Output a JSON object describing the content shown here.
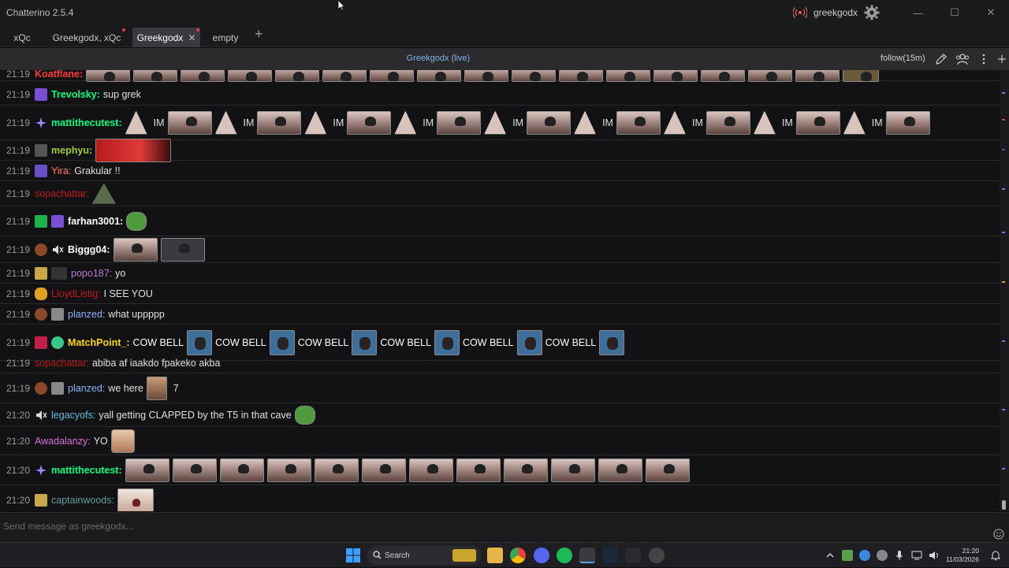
{
  "window": {
    "app_title": "Chatterino 2.5.4",
    "username": "greekgodx",
    "min_label": "—",
    "max_label": "☐",
    "close_label": "✕"
  },
  "tabs": [
    {
      "label": "xQc",
      "active": false
    },
    {
      "label": "Greekgodx, xQc",
      "active": false
    },
    {
      "label": "Greekgodx",
      "active": true
    },
    {
      "label": "empty",
      "active": false
    }
  ],
  "add_tab_label": "+",
  "channel_header": {
    "title": "Greekgodx (live)",
    "follow_mode": "follow(15m)"
  },
  "chat": [
    {
      "ts": "21:19",
      "user": "Koatflane:",
      "color": "#ff3b3b",
      "text": "",
      "emotes": "row"
    },
    {
      "ts": "21:19",
      "user": "Trevolsky:",
      "color": "#00ff7f",
      "text": "sup grek"
    },
    {
      "ts": "21:19",
      "user": "mattithecutest:",
      "color": "#00ff7f",
      "text": "",
      "im_label": "IM"
    },
    {
      "ts": "21:19",
      "user": "mephyu:",
      "color": "#9acd32",
      "text": ""
    },
    {
      "ts": "21:19",
      "user": "Yira:",
      "color": "#ff7f50",
      "text": "Grakular !!"
    },
    {
      "ts": "21:19",
      "user": "sopachattar:",
      "color": "#c11a1a",
      "text": ""
    },
    {
      "ts": "21:19",
      "user": "farhan3001:",
      "color": "#ffffff",
      "text": ""
    },
    {
      "ts": "21:19",
      "user": "Biggg04:",
      "color": "#ffffff",
      "text": ""
    },
    {
      "ts": "21:19",
      "user": "popo187:",
      "color": "#b77bd6",
      "text": "yo"
    },
    {
      "ts": "21:19",
      "user": "LloydListig:",
      "color": "#c11a1a",
      "text": "I SEE YOU"
    },
    {
      "ts": "21:19",
      "user": "planzed:",
      "color": "#8ab4f8",
      "text": "what uppppp"
    },
    {
      "ts": "21:19",
      "user": "MatchPoint_:",
      "color": "#ffd700",
      "text": "",
      "bell_label": "COW BELL"
    },
    {
      "ts": "21:19",
      "user": "sopachattar:",
      "color": "#c11a1a",
      "text": "abiba af iaakdo fpakeko akba"
    },
    {
      "ts": "21:19",
      "user": "planzed:",
      "color": "#8ab4f8",
      "text": "we here",
      "text2": "7"
    },
    {
      "ts": "21:20",
      "user": "legacyofs:",
      "color": "#5bc0de",
      "text": "yall getting CLAPPED by the T5 in that cave"
    },
    {
      "ts": "21:20",
      "user": "Awadalanzy:",
      "color": "#da70d6",
      "text": "YO"
    },
    {
      "ts": "21:20",
      "user": "mattithecutest:",
      "color": "#00ff7f",
      "text": ""
    },
    {
      "ts": "21:20",
      "user": "captainwoods:",
      "color": "#5f9ea0",
      "text": ""
    }
  ],
  "input": {
    "placeholder": "Send message as greekgodx..."
  },
  "taskbar": {
    "search_label": "Search",
    "time": "21:20",
    "date": "11/03/2026"
  },
  "colors": {
    "accent": "#7fb3e6",
    "background": "#121214"
  }
}
